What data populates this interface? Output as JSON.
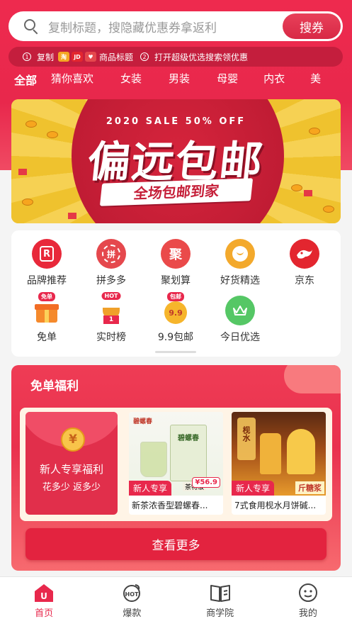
{
  "search": {
    "placeholder": "复制标题，搜隐藏优惠券拿返利",
    "button_label": "搜券"
  },
  "tip_bar": {
    "step1_num": "1",
    "step1_text": "复制",
    "step1_suffix": "商品标题",
    "step2_num": "2",
    "step2_text": "打开超级优选搜索领优惠",
    "mini_logo_2": "JD"
  },
  "tabs": [
    "全部",
    "猜你喜欢",
    "女装",
    "男装",
    "母婴",
    "内衣",
    "美"
  ],
  "banner": {
    "subtitle": "2020 SALE 50% OFF",
    "title": "偏远包邮",
    "tagline": "全场包邮到家"
  },
  "categories": [
    {
      "label": "品牌推荐",
      "icon": "brand-icon",
      "glyph": "R",
      "color": "#e8283a"
    },
    {
      "label": "拼多多",
      "icon": "pinduoduo-icon",
      "glyph": "拼",
      "color": "#e5484d"
    },
    {
      "label": "聚划算",
      "icon": "juhuasuan-icon",
      "glyph": "聚",
      "color": "#ea4a4a"
    },
    {
      "label": "好货精选",
      "icon": "good-goods-icon",
      "glyph": "",
      "color": "#f3a92c"
    },
    {
      "label": "京东",
      "icon": "jd-icon",
      "glyph": "",
      "color": "#e3262f"
    },
    {
      "label": "免单",
      "icon": "free-order-icon",
      "glyph": "",
      "color": "#f58a2c",
      "badge": "免单"
    },
    {
      "label": "实时榜",
      "icon": "ranking-icon",
      "glyph": "1",
      "color": "#f0a02a",
      "badge": "HOT"
    },
    {
      "label": "9.9包邮",
      "icon": "nine-nine-icon",
      "glyph": "9.9",
      "color": "#f6b52c",
      "badge": "包邮"
    },
    {
      "label": "今日优选",
      "icon": "today-pick-icon",
      "glyph": "",
      "color": "#55c765"
    }
  ],
  "welfare": {
    "title": "免单福利",
    "newuser_title": "新人专享福利",
    "newuser_sub": "花多少 返多少",
    "coin_glyph": "¥",
    "products": [
      {
        "name": "新茶浓香型碧螺春...",
        "tag": "新人专享",
        "label": "碧螺春",
        "price": "¥56.9",
        "grade": "茶特级"
      },
      {
        "name": "7式食用枧水月饼碱...",
        "tag": "新人专享",
        "label": "枧水",
        "promo": "斤糖浆"
      }
    ],
    "more_label": "查看更多"
  },
  "tabbar": [
    {
      "label": "首页",
      "icon": "home-icon",
      "active": true
    },
    {
      "label": "爆款",
      "icon": "hot-icon",
      "active": false
    },
    {
      "label": "商学院",
      "icon": "book-icon",
      "active": false
    },
    {
      "label": "我的",
      "icon": "profile-icon",
      "active": false
    }
  ],
  "colors": {
    "primary": "#e8284c",
    "primary_dark": "#c41e3d"
  }
}
